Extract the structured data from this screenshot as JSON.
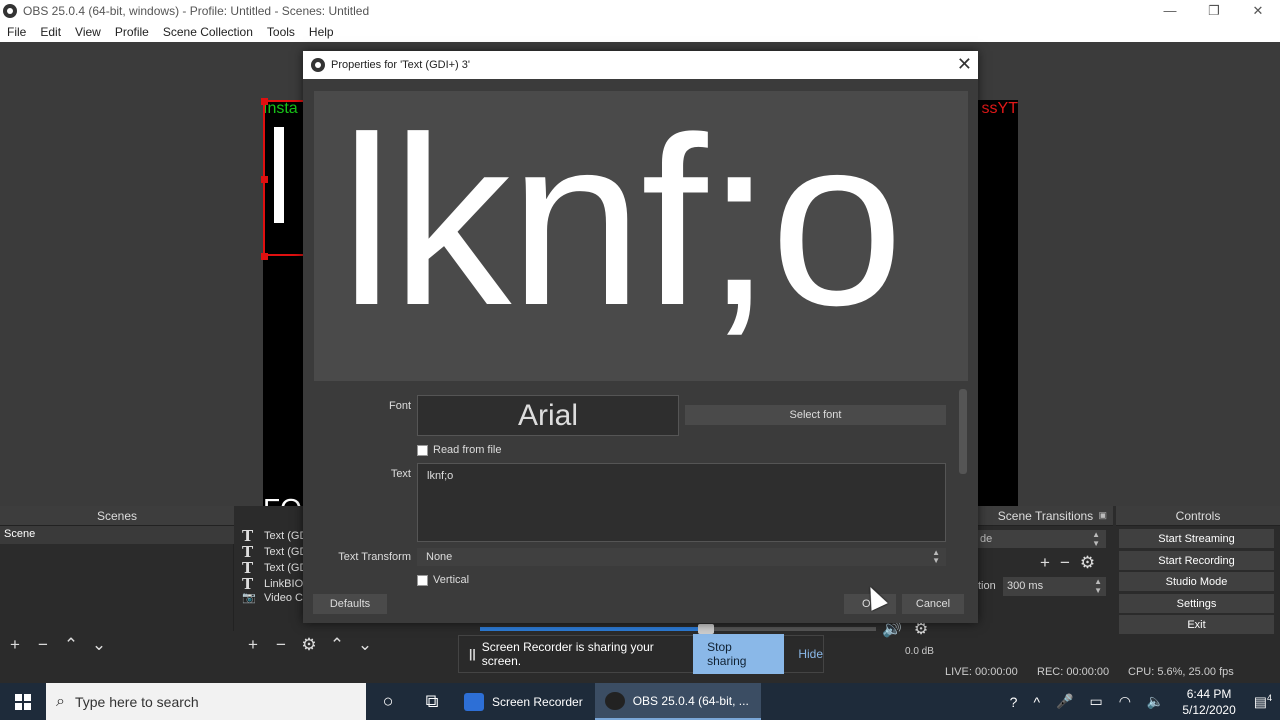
{
  "window": {
    "title": "OBS 25.0.4 (64-bit, windows) - Profile: Untitled - Scenes: Untitled",
    "minimize_glyph": "—",
    "restore_glyph": "❐",
    "close_glyph": "✕"
  },
  "menu": [
    "File",
    "Edit",
    "View",
    "Profile",
    "Scene Collection",
    "Tools",
    "Help"
  ],
  "canvas": {
    "top_left_text": "Insta",
    "top_right_text": "ssYT",
    "bottom_text": "FO"
  },
  "scenes_dock": {
    "title": "Scenes",
    "items": [
      "Scene"
    ]
  },
  "sources_dock": {
    "items": [
      {
        "icon": "T",
        "label": "Text (GD"
      },
      {
        "icon": "T",
        "label": "Text (GD"
      },
      {
        "icon": "T",
        "label": "Text (GD"
      },
      {
        "icon": "T",
        "label": "LinkBIO"
      },
      {
        "icon": "📷",
        "label": "Video Ca"
      }
    ]
  },
  "transitions_dock": {
    "title": "Scene Transitions",
    "selected": "de",
    "duration_label": "tion",
    "duration_value": "300 ms"
  },
  "controls_dock": {
    "title": "Controls",
    "buttons": [
      "Start Streaming",
      "Start Recording",
      "Studio Mode",
      "Settings",
      "Exit"
    ]
  },
  "status": {
    "live": "LIVE: 00:00:00",
    "rec": "REC: 00:00:00",
    "cpu": "CPU: 5.6%, 25.00 fps"
  },
  "mixer": {
    "volume_level": 0.57,
    "db": "0.0 dB"
  },
  "share_banner": {
    "pause_glyph": "||",
    "message": "Screen Recorder is sharing your screen.",
    "stop_label": "Stop sharing",
    "hide_label": "Hide"
  },
  "dialog": {
    "title": "Properties for 'Text (GDI+) 3'",
    "preview_text": "lknf;o",
    "font_label": "Font",
    "font_value": "Arial",
    "select_font_label": "Select font",
    "read_from_file_label": "Read from file",
    "text_label": "Text",
    "text_value": "lknf;o",
    "text_transform_label": "Text Transform",
    "text_transform_value": "None",
    "vertical_label": "Vertical",
    "defaults_label": "Defaults",
    "ok_label": "OK",
    "cancel_label": "Cancel"
  },
  "taskbar": {
    "search_placeholder": "Type here to search",
    "apps": [
      {
        "label": "Screen Recorder",
        "active": false
      },
      {
        "label": "OBS 25.0.4 (64-bit, ...",
        "active": true
      }
    ],
    "time": "6:44 PM",
    "date": "5/12/2020",
    "notification_count": "4"
  },
  "colors": {
    "obs_dark": "#2b2b2b",
    "dock_header": "#3d3d3d",
    "accent_blue": "#2d7bd6",
    "selection_red": "#e01010",
    "taskbar": "#1e2b3a"
  }
}
